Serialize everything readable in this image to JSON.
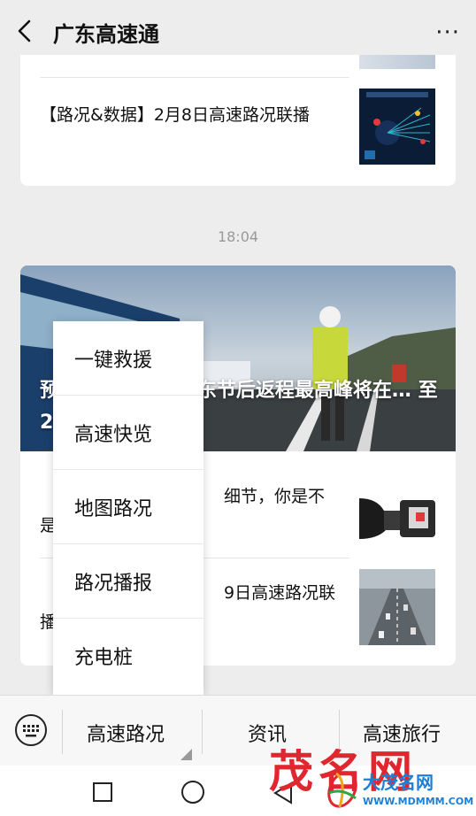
{
  "header": {
    "title": "广东高速通",
    "more": "···"
  },
  "articles_top": {
    "item1": "【路况&数据】2月8日高速路况联播"
  },
  "timestamp": "18:04",
  "article_group": {
    "hero_title": "预计2月10日，广东节后返程最高峰将在… 至20时",
    "item2_text": "细节，你是不",
    "item2_prefix": "是",
    "item3_text": "9日高速路况联",
    "item3_prefix": "播"
  },
  "popup_menu": {
    "items": [
      "一键救援",
      "高速快览",
      "地图路况",
      "路况播报",
      "充电桩"
    ]
  },
  "bottom_menu": {
    "tabs": [
      "高速路况",
      "资讯",
      "高速旅行"
    ]
  },
  "watermark": {
    "brand": "茂名网",
    "small": "大茂名网",
    "url": "WWW.MDMMM.COM"
  },
  "colors": {
    "background": "#ededed",
    "watermark_red": "#e0262e",
    "watermark_blue": "#1c7fd4"
  }
}
